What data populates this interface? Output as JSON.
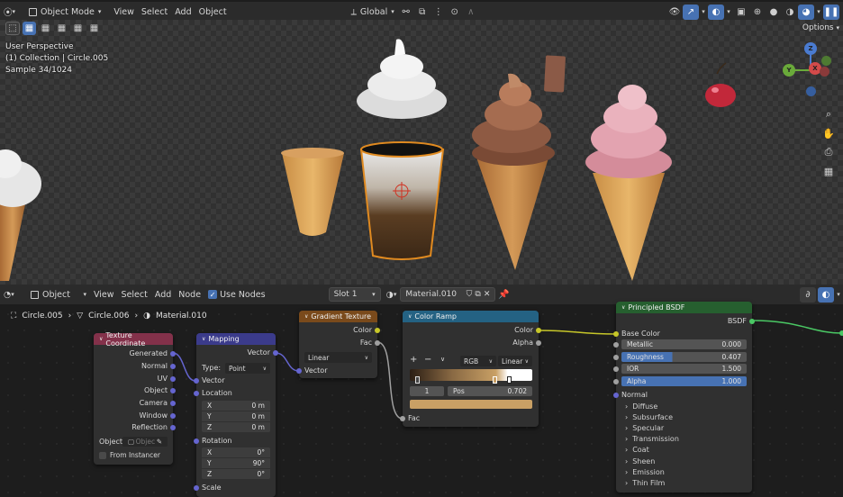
{
  "viewport_header": {
    "mode": "Object Mode",
    "menus": [
      "View",
      "Select",
      "Add",
      "Object"
    ],
    "transform_orientation": "Global",
    "options_label": "Options"
  },
  "viewport": {
    "overlay_lines": [
      "User Perspective",
      "(1) Collection | Circle.005",
      "Sample 34/1024"
    ],
    "gizmo_axes": [
      "Z",
      "Y",
      "X"
    ]
  },
  "node_header": {
    "type": "Object",
    "menus": [
      "View",
      "Select",
      "Add",
      "Node"
    ],
    "use_nodes_label": "Use Nodes",
    "slot": "Slot 1",
    "material": "Material.010"
  },
  "breadcrumb": [
    "Circle.005",
    "Circle.006",
    "Material.010"
  ],
  "nodes": {
    "texcoord": {
      "title": "Texture Coordinate",
      "outputs": [
        "Generated",
        "Normal",
        "UV",
        "Object",
        "Camera",
        "Window",
        "Reflection"
      ],
      "object_label": "Object:",
      "object_placeholder": "Objec",
      "from_instancer": "From Instancer"
    },
    "mapping": {
      "title": "Mapping",
      "output": "Vector",
      "type_label": "Type:",
      "type_value": "Point",
      "inputs": [
        "Vector",
        "Location"
      ],
      "location": [
        {
          "axis": "X",
          "value": "0 m"
        },
        {
          "axis": "Y",
          "value": "0 m"
        },
        {
          "axis": "Z",
          "value": "0 m"
        }
      ],
      "rotation_label": "Rotation",
      "rotation": [
        {
          "axis": "X",
          "value": "0°"
        },
        {
          "axis": "Y",
          "value": "90°"
        },
        {
          "axis": "Z",
          "value": "0°"
        }
      ],
      "scale_label": "Scale"
    },
    "gradient": {
      "title": "Gradient Texture",
      "outputs": [
        "Color",
        "Fac"
      ],
      "type_value": "Linear",
      "input": "Vector"
    },
    "colorramp": {
      "title": "Color Ramp",
      "outputs": [
        "Color",
        "Alpha"
      ],
      "color_mode": "RGB",
      "interpolation": "Linear",
      "index": "1",
      "pos_label": "Pos",
      "pos_value": "0.702",
      "input": "Fac",
      "swatch_color": "#c9a065"
    },
    "bsdf": {
      "title": "Principled BSDF",
      "output": "BSDF",
      "base_color_label": "Base Color",
      "fields": [
        {
          "label": "Metallic",
          "value": "0.000",
          "fill": 0.0
        },
        {
          "label": "Roughness",
          "value": "0.407",
          "fill": 0.407
        },
        {
          "label": "IOR",
          "value": "1.500",
          "fill": 0.0
        },
        {
          "label": "Alpha",
          "value": "1.000",
          "fill": 1.0
        }
      ],
      "normal_label": "Normal",
      "panels": [
        "Diffuse",
        "Subsurface",
        "Specular",
        "Transmission",
        "Coat",
        "Sheen",
        "Emission",
        "Thin Film"
      ]
    }
  },
  "colors": {
    "accent": "#4772b3",
    "texcoord_header": "#83314a",
    "mapping_header": "#3b3b8b",
    "gradient_header": "#7a4a1b",
    "colorramp_header": "#246283",
    "bsdf_header": "#265f2f"
  }
}
